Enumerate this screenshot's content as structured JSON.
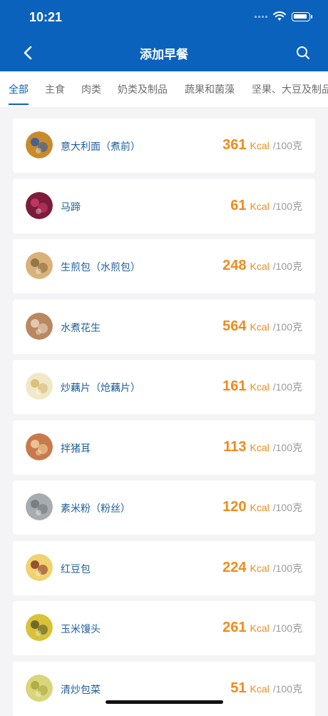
{
  "status_bar": {
    "time": "10:21"
  },
  "nav": {
    "title": "添加早餐"
  },
  "tabs": [
    {
      "label": "全部",
      "active": true
    },
    {
      "label": "主食",
      "active": false
    },
    {
      "label": "肉类",
      "active": false
    },
    {
      "label": "奶类及制品",
      "active": false
    },
    {
      "label": "蔬果和菌藻",
      "active": false
    },
    {
      "label": "坚果、大豆及制品",
      "active": false
    }
  ],
  "colors": {
    "primary": "#0a62bd",
    "accent": "#f08a1c",
    "name": "#1f5f9b"
  },
  "unit_label": "Kcal",
  "per_label": "/100克",
  "foods": [
    {
      "name": "意大利面（煮前）",
      "kcal": "361",
      "icon": "pasta-icon",
      "c1": "#c88a2a",
      "c2": "#2d5aa8"
    },
    {
      "name": "马蹄",
      "kcal": "61",
      "icon": "water-chestnut-icon",
      "c1": "#7a1c3a",
      "c2": "#c93b6a"
    },
    {
      "name": "生煎包（水煎包）",
      "kcal": "248",
      "icon": "pan-fried-bun-icon",
      "c1": "#d8b27a",
      "c2": "#8a6a3a"
    },
    {
      "name": "水煮花生",
      "kcal": "564",
      "icon": "peanut-icon",
      "c1": "#b98860",
      "c2": "#e9d6c0"
    },
    {
      "name": "炒藕片（炝藕片）",
      "kcal": "161",
      "icon": "lotus-root-icon",
      "c1": "#efe9c8",
      "c2": "#d7b870"
    },
    {
      "name": "拌猪耳",
      "kcal": "113",
      "icon": "pork-ear-icon",
      "c1": "#c97a4a",
      "c2": "#f0d0a0"
    },
    {
      "name": "素米粉（粉丝）",
      "kcal": "120",
      "icon": "vermicelli-icon",
      "c1": "#a7acb0",
      "c2": "#70767c"
    },
    {
      "name": "红豆包",
      "kcal": "224",
      "icon": "red-bean-bun-icon",
      "c1": "#f0d270",
      "c2": "#8a3a2a"
    },
    {
      "name": "玉米馒头",
      "kcal": "261",
      "icon": "corn-bun-icon",
      "c1": "#d8c23a",
      "c2": "#5a5a2a"
    },
    {
      "name": "清炒包菜",
      "kcal": "51",
      "icon": "cabbage-icon",
      "c1": "#d9d57a",
      "c2": "#a7a83a"
    }
  ]
}
